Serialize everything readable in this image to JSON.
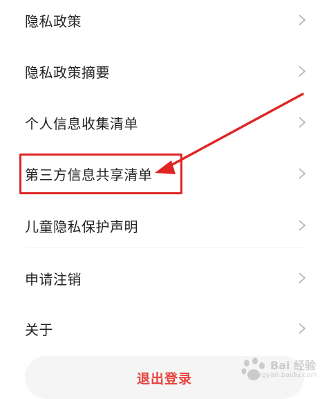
{
  "menu": {
    "items": [
      {
        "label": "隐私政策"
      },
      {
        "label": "隐私政策摘要"
      },
      {
        "label": "个人信息收集清单"
      },
      {
        "label": "第三方信息共享清单"
      },
      {
        "label": "儿童隐私保护声明"
      },
      {
        "label": "申请注销"
      },
      {
        "label": "关于"
      }
    ]
  },
  "logout": {
    "label": "退出登录"
  },
  "colors": {
    "accent": "#e02424",
    "logout_text": "#e8413b",
    "chevron": "#b5b5b5"
  },
  "annotation": {
    "highlighted_item": "第三方信息共享清单"
  },
  "watermark": {
    "brand": "Bai 经验",
    "url": "jingyan.baidu.com"
  }
}
